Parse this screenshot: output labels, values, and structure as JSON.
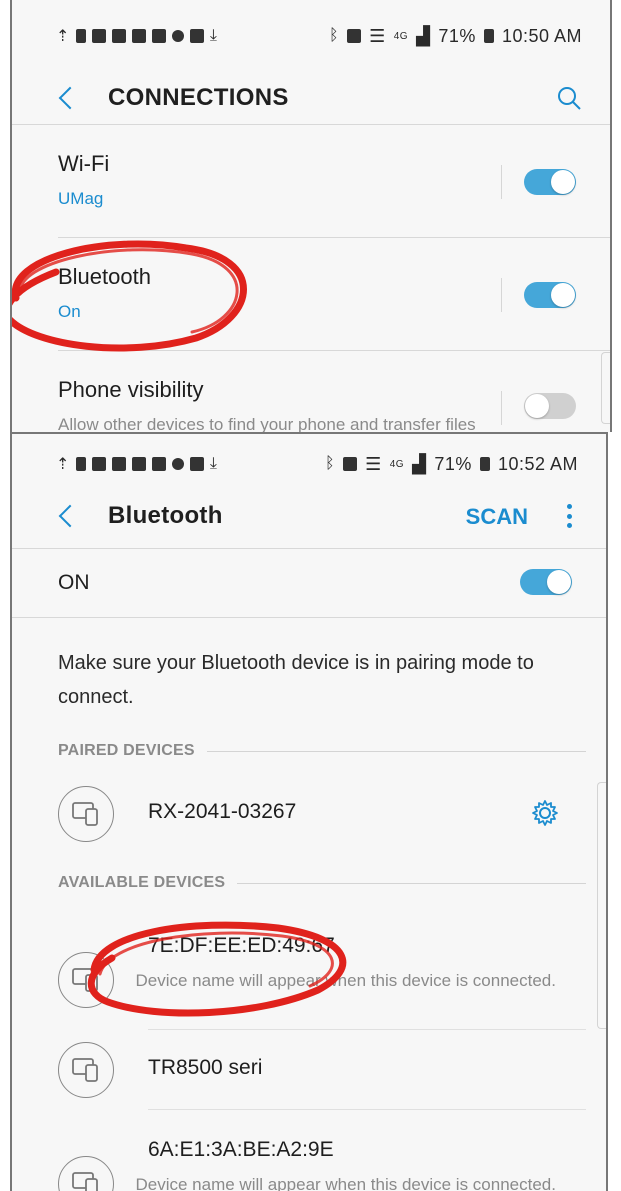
{
  "connections_screen": {
    "status_bar": {
      "battery": "71%",
      "time": "10:50 AM",
      "network": "4G"
    },
    "header": {
      "title": "CONNECTIONS"
    },
    "settings": [
      {
        "title": "Wi-Fi",
        "subtitle": "UMag",
        "enabled": true
      },
      {
        "title": "Bluetooth",
        "subtitle": "On",
        "enabled": true
      },
      {
        "title": "Phone visibility",
        "subtitle": "Allow other devices to find your phone and transfer files",
        "enabled": false
      }
    ]
  },
  "bluetooth_screen": {
    "status_bar": {
      "battery": "71%",
      "time": "10:52 AM",
      "network": "4G"
    },
    "header": {
      "title": "Bluetooth",
      "scan_label": "SCAN"
    },
    "master_toggle": {
      "label": "ON",
      "enabled": true
    },
    "help_text": "Make sure your Bluetooth device is in pairing mode to connect.",
    "paired_header": "PAIRED DEVICES",
    "paired_devices": [
      {
        "name": "RX-2041-03267"
      }
    ],
    "available_header": "AVAILABLE DEVICES",
    "available_devices": [
      {
        "name": "7E:DF:EE:ED:49:67",
        "subtitle": "Device name will appear when this device is connected."
      },
      {
        "name": "TR8500 seri",
        "subtitle": ""
      },
      {
        "name": "6A:E1:3A:BE:A2:9E",
        "subtitle": "Device name will appear when this device is connected."
      }
    ]
  },
  "colors": {
    "accent": "#1b8ccf",
    "toggle_on": "#45a7d9",
    "annotation_red": "#e0221c"
  },
  "icons": [
    "back-icon",
    "search-icon",
    "more-icon",
    "gear-icon",
    "devices-icon",
    "bluetooth-icon",
    "wifi-icon",
    "battery-icon"
  ]
}
